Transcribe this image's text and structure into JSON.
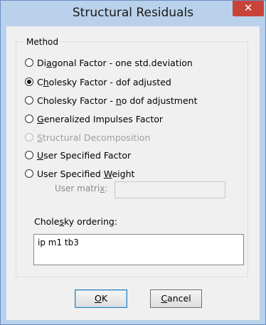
{
  "window": {
    "title": "Structural Residuals",
    "close_glyph": "✕"
  },
  "method": {
    "group_label": "Method",
    "options": [
      {
        "pre": "Di",
        "key": "a",
        "post": "gonal Factor - one std.deviation",
        "checked": false,
        "disabled": false
      },
      {
        "pre": "C",
        "key": "h",
        "post": "olesky Factor - dof adjusted",
        "checked": true,
        "disabled": false
      },
      {
        "pre": "Cholesky Factor - ",
        "key": "n",
        "post": "o dof adjustment",
        "checked": false,
        "disabled": false
      },
      {
        "pre": "",
        "key": "G",
        "post": "eneralized Impulses Factor",
        "checked": false,
        "disabled": false
      },
      {
        "pre": "",
        "key": "S",
        "post": "tructural Decomposition",
        "checked": false,
        "disabled": true
      },
      {
        "pre": "",
        "key": "U",
        "post": "ser Specified Factor",
        "checked": false,
        "disabled": false
      },
      {
        "pre": "User Specified ",
        "key": "W",
        "post": "eight",
        "checked": false,
        "disabled": false
      }
    ],
    "user_matrix": {
      "label_pre": "User matri",
      "label_key": "x",
      "label_post": ":",
      "value": ""
    }
  },
  "ordering": {
    "label_pre": "Chole",
    "label_key": "s",
    "label_post": "ky ordering:",
    "value": "ip m1 tb3"
  },
  "buttons": {
    "ok": {
      "key": "O",
      "post": "K"
    },
    "cancel": {
      "key": "C",
      "post": "ancel"
    }
  }
}
